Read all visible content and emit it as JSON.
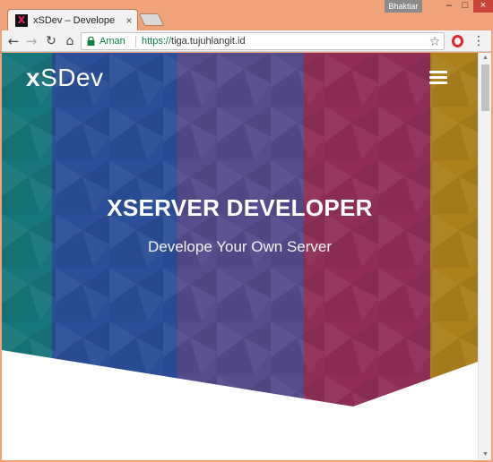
{
  "browser": {
    "tab": {
      "favicon": "X",
      "title": "xSDev – Develope YOur O",
      "close": "×"
    },
    "user_badge": "Bhaktiar",
    "window_controls": {
      "minimize": "–",
      "maximize": "□",
      "close": "×"
    },
    "nav": {
      "back": "←",
      "forward": "→",
      "reload": "↻",
      "home": "⌂"
    },
    "address": {
      "security_label": "Aman",
      "url_scheme": "https://",
      "url_host": "tiga.tujuhlangit.id"
    },
    "bookmark": "☆",
    "menu": "⋮"
  },
  "page": {
    "brand": {
      "prefix": "x",
      "rest": "SDev"
    },
    "hero": {
      "title": "XSERVER DEVELOPER",
      "subtitle": "Develope Your Own Server"
    }
  },
  "theme": {
    "stripes": [
      "#137a7a",
      "#2a4e9a",
      "#5a4a8c",
      "#9b2a52",
      "#b9860f"
    ],
    "accent_secure": "#0b8043",
    "window_frame": "#f0a27a"
  },
  "icons": [
    "lock-icon",
    "star-icon",
    "opera-icon",
    "menu-icon",
    "hamburger-icon",
    "close-icon"
  ]
}
